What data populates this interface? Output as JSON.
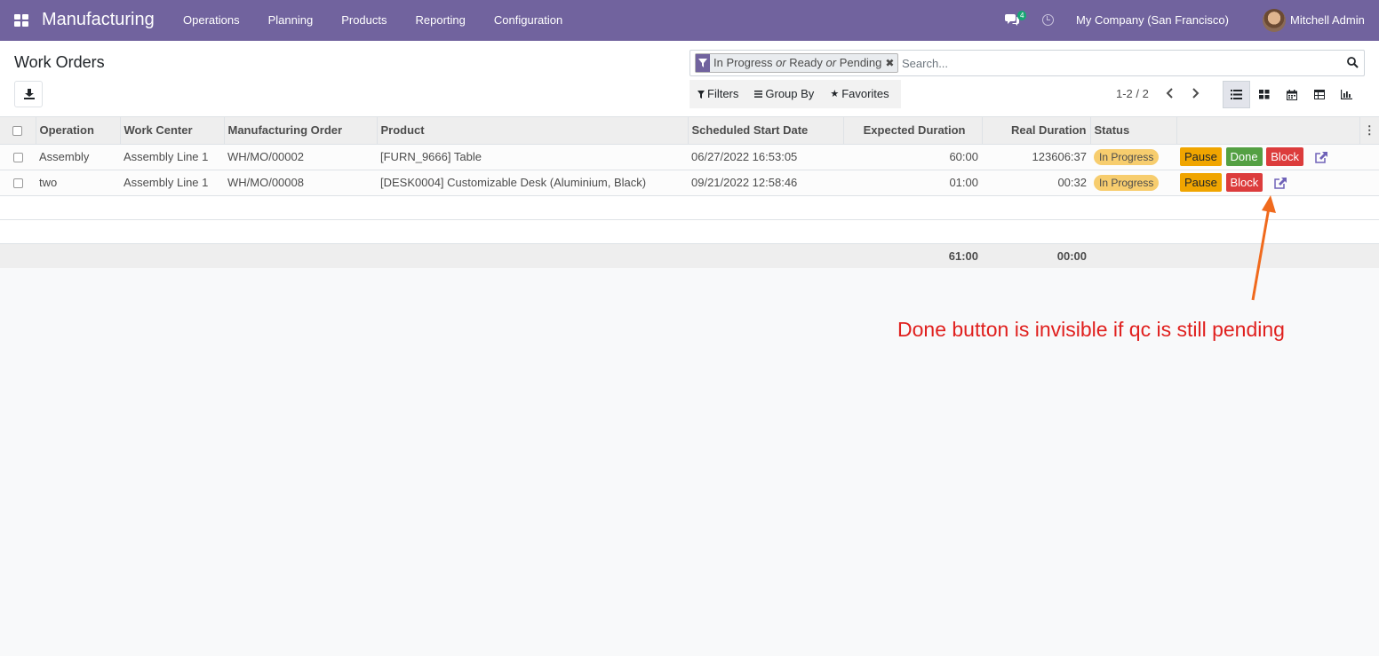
{
  "navbar": {
    "app_title": "Manufacturing",
    "menu": [
      "Operations",
      "Planning",
      "Products",
      "Reporting",
      "Configuration"
    ],
    "chat_count": "4",
    "company": "My Company (San Francisco)",
    "user": "Mitchell Admin",
    "colors": {
      "brand": "#71639e"
    }
  },
  "control_panel": {
    "title": "Work Orders",
    "facet": {
      "part1": "In Progress",
      "sep1": "or",
      "part2": "Ready",
      "sep2": "or",
      "part3": "Pending"
    },
    "search_placeholder": "Search...",
    "filters_label": "Filters",
    "groupby_label": "Group By",
    "favorites_label": "Favorites",
    "pager": "1-2 / 2",
    "views": [
      "list",
      "kanban",
      "calendar",
      "pivot",
      "graph"
    ],
    "active_view": "list"
  },
  "table": {
    "headers": [
      "Operation",
      "Work Center",
      "Manufacturing Order",
      "Product",
      "Scheduled Start Date",
      "Expected Duration",
      "Real Duration",
      "Status"
    ],
    "rows": [
      {
        "operation": "Assembly",
        "work_center": "Assembly Line 1",
        "mo": "WH/MO/00002",
        "product": "[FURN_9666] Table",
        "start": "06/27/2022 16:53:05",
        "expected": "60:00",
        "real": "123606:37",
        "status": "In Progress",
        "buttons": [
          "Pause",
          "Done",
          "Block"
        ]
      },
      {
        "operation": "two",
        "work_center": "Assembly Line 1",
        "mo": "WH/MO/00008",
        "product": "[DESK0004] Customizable Desk (Aluminium, Black)",
        "start": "09/21/2022 12:58:46",
        "expected": "01:00",
        "real": "00:32",
        "status": "In Progress",
        "buttons": [
          "Pause",
          "Block"
        ]
      }
    ],
    "totals": {
      "expected": "61:00",
      "real": "00:00"
    }
  },
  "annotation": {
    "text": "Done button is invisible if qc is still pending",
    "color": "#e0201e",
    "arrow_color": "#f06a1d"
  }
}
